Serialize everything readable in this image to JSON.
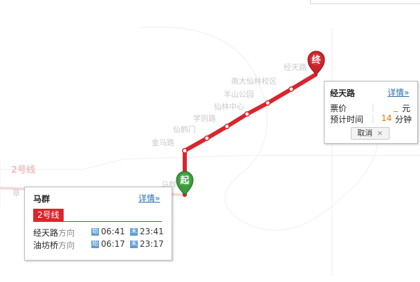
{
  "map": {
    "background_line_label": "2号线",
    "background_line_label_2": "草",
    "route_color": "#d7262d",
    "stations": [
      "马群",
      "金马路",
      "仙鹤门",
      "学则路",
      "仙林中心",
      "羊山公园",
      "南大仙林校区",
      "经天路"
    ],
    "start_marker": "起",
    "end_marker": "终",
    "faint_station_near_start": "马群"
  },
  "end_popup": {
    "station": "经天路",
    "detail_label": "详情",
    "detail_icon": "double-chevron-right-icon",
    "fare_label": "票价",
    "fare_value": "_",
    "fare_unit": "元",
    "time_label": "预计时间",
    "time_value": "14",
    "time_unit": "分钟",
    "cancel_label": "取消",
    "cancel_icon": "close-icon"
  },
  "start_popup": {
    "station": "马群",
    "detail_label": "详情",
    "detail_icon": "double-chevron-right-icon",
    "line_tab": "2号线",
    "directions": [
      {
        "terminal": "经天路",
        "dir_word": "方向",
        "first_icon": "始",
        "first_time": "06:41",
        "last_icon": "末",
        "last_time": "23:41"
      },
      {
        "terminal": "油坊桥",
        "dir_word": "方向",
        "first_icon": "始",
        "first_time": "06:17",
        "last_icon": "末",
        "last_time": "23:17"
      }
    ]
  }
}
